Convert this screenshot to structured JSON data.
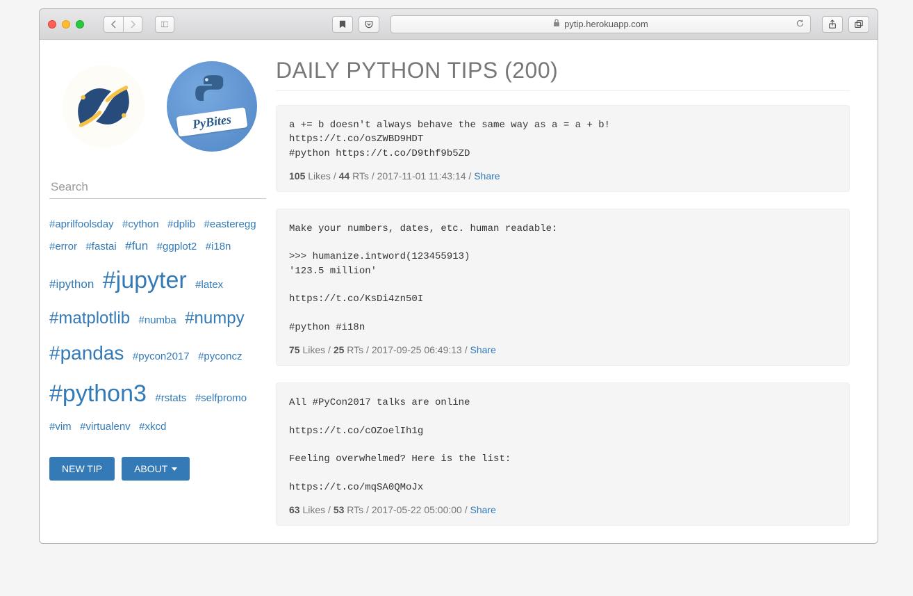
{
  "browser": {
    "url": "pytip.herokuapp.com"
  },
  "sidebar": {
    "pybites_label": "PyBites",
    "search_placeholder": "Search",
    "tags": [
      {
        "label": "#aprilfoolsday",
        "size": 1
      },
      {
        "label": "#cython",
        "size": 1
      },
      {
        "label": "#dplib",
        "size": 1
      },
      {
        "label": "#easteregg",
        "size": 1
      },
      {
        "label": "#error",
        "size": 1
      },
      {
        "label": "#fastai",
        "size": 1
      },
      {
        "label": "#fun",
        "size": 2
      },
      {
        "label": "#ggplot2",
        "size": 1
      },
      {
        "label": "#i18n",
        "size": 1
      },
      {
        "label": "#ipython",
        "size": 2
      },
      {
        "label": "#jupyter",
        "size": 5
      },
      {
        "label": "#latex",
        "size": 1
      },
      {
        "label": "#matplotlib",
        "size": 3
      },
      {
        "label": "#numba",
        "size": 1
      },
      {
        "label": "#numpy",
        "size": 3
      },
      {
        "label": "#pandas",
        "size": 4
      },
      {
        "label": "#pycon2017",
        "size": 1
      },
      {
        "label": "#pyconcz",
        "size": 1
      },
      {
        "label": "#python3",
        "size": 5
      },
      {
        "label": "#rstats",
        "size": 1
      },
      {
        "label": "#selfpromo",
        "size": 1
      },
      {
        "label": "#vim",
        "size": 1
      },
      {
        "label": "#virtualenv",
        "size": 1
      },
      {
        "label": "#xkcd",
        "size": 1
      }
    ],
    "new_tip_label": "NEW TIP",
    "about_label": "ABOUT"
  },
  "main": {
    "title": "DAILY PYTHON TIPS (200)",
    "share_label": "Share",
    "likes_label": "Likes",
    "rts_label": "RTs",
    "tips": [
      {
        "text": "a += b doesn't always behave the same way as a = a + b!\nhttps://t.co/osZWBD9HDT\n#python https://t.co/D9thf9b5ZD",
        "likes": "105",
        "rts": "44",
        "timestamp": "2017-11-01 11:43:14"
      },
      {
        "text": "Make your numbers, dates, etc. human readable:\n\n>>> humanize.intword(123455913)\n'123.5 million'\n\nhttps://t.co/KsDi4zn50I\n\n#python #i18n",
        "likes": "75",
        "rts": "25",
        "timestamp": "2017-09-25 06:49:13"
      },
      {
        "text": "All #PyCon2017 talks are online\n\nhttps://t.co/cOZoelIh1g\n\nFeeling overwhelmed? Here is the list:\n\nhttps://t.co/mqSA0QMoJx",
        "likes": "63",
        "rts": "53",
        "timestamp": "2017-05-22 05:00:00"
      }
    ]
  }
}
